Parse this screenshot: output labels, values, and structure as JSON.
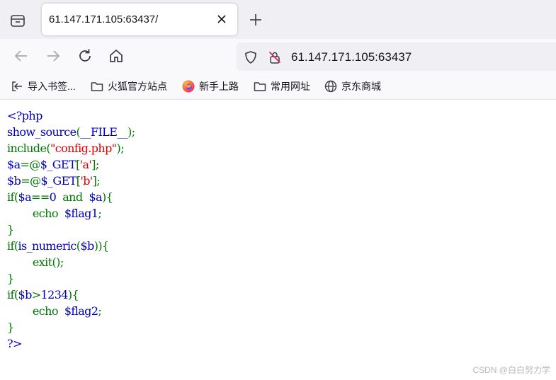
{
  "browser": {
    "tab": {
      "title": "61.147.171.105:63437/"
    },
    "url": "61.147.171.105:63437",
    "bookmarks": [
      {
        "label": "导入书签...",
        "icon": "import-icon"
      },
      {
        "label": "火狐官方站点",
        "icon": "folder-icon"
      },
      {
        "label": "新手上路",
        "icon": "firefox-icon"
      },
      {
        "label": "常用网址",
        "icon": "folder-icon"
      },
      {
        "label": "京东商城",
        "icon": "globe-icon"
      }
    ]
  },
  "source": {
    "colors": {
      "default": "#0000bb",
      "keyword": "#007700",
      "string": "#dd0000"
    },
    "lines": [
      [
        {
          "t": "<?php",
          "c": "def"
        }
      ],
      [
        {
          "t": "show_source",
          "c": "def"
        },
        {
          "t": "(",
          "c": "kw"
        },
        {
          "t": "__FILE__",
          "c": "def"
        },
        {
          "t": ");",
          "c": "kw"
        }
      ],
      [
        {
          "t": "include(",
          "c": "kw"
        },
        {
          "t": "\"config.php\"",
          "c": "str"
        },
        {
          "t": ");",
          "c": "kw"
        }
      ],
      [
        {
          "t": "$a",
          "c": "def"
        },
        {
          "t": "=@",
          "c": "kw"
        },
        {
          "t": "$_GET",
          "c": "def"
        },
        {
          "t": "[",
          "c": "kw"
        },
        {
          "t": "'a'",
          "c": "str"
        },
        {
          "t": "];",
          "c": "kw"
        }
      ],
      [
        {
          "t": "$b",
          "c": "def"
        },
        {
          "t": "=@",
          "c": "kw"
        },
        {
          "t": "$_GET",
          "c": "def"
        },
        {
          "t": "[",
          "c": "kw"
        },
        {
          "t": "'b'",
          "c": "str"
        },
        {
          "t": "];",
          "c": "kw"
        }
      ],
      [
        {
          "t": "if(",
          "c": "kw"
        },
        {
          "t": "$a",
          "c": "def"
        },
        {
          "t": "==",
          "c": "kw"
        },
        {
          "t": "0 ",
          "c": "def"
        },
        {
          "t": " and  ",
          "c": "kw"
        },
        {
          "t": "$a",
          "c": "def"
        },
        {
          "t": "){",
          "c": "kw"
        }
      ],
      [
        {
          "t": "        echo  ",
          "c": "kw"
        },
        {
          "t": "$flag1",
          "c": "def"
        },
        {
          "t": ";",
          "c": "kw"
        }
      ],
      [
        {
          "t": "}",
          "c": "kw"
        }
      ],
      [
        {
          "t": "if(",
          "c": "kw"
        },
        {
          "t": "is_numeric",
          "c": "def"
        },
        {
          "t": "(",
          "c": "kw"
        },
        {
          "t": "$b",
          "c": "def"
        },
        {
          "t": ")){",
          "c": "kw"
        }
      ],
      [
        {
          "t": "        exit",
          "c": "kw"
        },
        {
          "t": "();",
          "c": "kw"
        }
      ],
      [
        {
          "t": "}",
          "c": "kw"
        }
      ],
      [
        {
          "t": "if(",
          "c": "kw"
        },
        {
          "t": "$b",
          "c": "def"
        },
        {
          "t": ">",
          "c": "kw"
        },
        {
          "t": "1234",
          "c": "def"
        },
        {
          "t": "){",
          "c": "kw"
        }
      ],
      [
        {
          "t": "        echo  ",
          "c": "kw"
        },
        {
          "t": "$flag2",
          "c": "def"
        },
        {
          "t": ";",
          "c": "kw"
        }
      ],
      [
        {
          "t": "}",
          "c": "kw"
        }
      ],
      [
        {
          "t": "?>",
          "c": "def"
        }
      ]
    ]
  },
  "watermark": "CSDN @白白努力学"
}
